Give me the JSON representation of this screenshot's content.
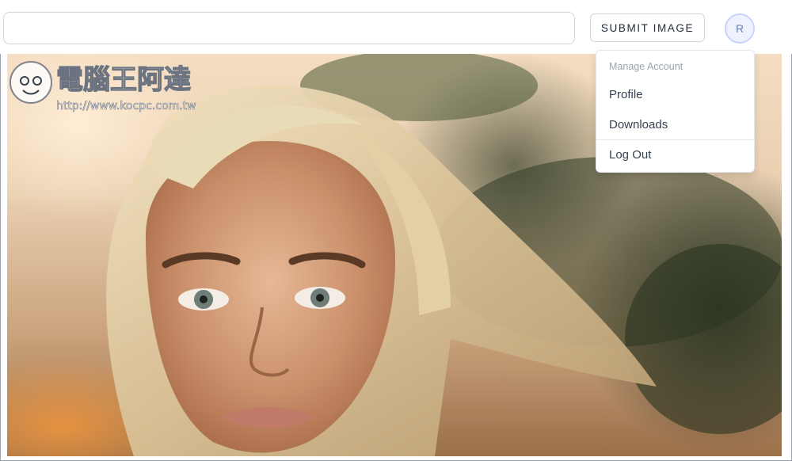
{
  "search": {
    "value": "",
    "placeholder": ""
  },
  "header": {
    "submit_label": "SUBMIT IMAGE",
    "avatar_initial": "R"
  },
  "account_menu": {
    "heading": "Manage Account",
    "items": [
      {
        "label": "Profile"
      },
      {
        "label": "Downloads"
      },
      {
        "label": "Log Out"
      }
    ]
  },
  "hero": {
    "image_subject": "portrait of a blonde woman at sunset with palm trees",
    "watermark": {
      "name": "電腦王阿達",
      "url": "http://www.kocpc.com.tw"
    }
  },
  "colors": {
    "border": "#d1d5db",
    "avatar_bg": "#eef2ff",
    "avatar_text": "#6b7fbf",
    "menu_muted": "#9ca3af",
    "watermark": "#6b7280"
  }
}
